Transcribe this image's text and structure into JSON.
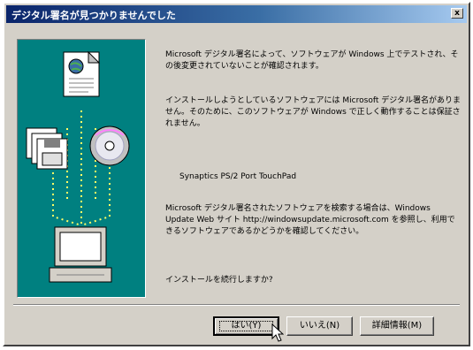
{
  "window": {
    "title": "デジタル署名が見つかりませんでした",
    "close_label": "x"
  },
  "messages": {
    "line1": "Microsoft デジタル署名によって、ソフトウェアが Windows 上でテストされ、その後変更されていないことが確認されます。",
    "line2": "インストールしようとしているソフトウェアには Microsoft デジタル署名がありません。そのために、このソフトウェアが Windows で正しく動作することは保証されません。",
    "device_name": "Synaptics PS/2 Port TouchPad",
    "line3": "Microsoft デジタル署名されたソフトウェアを検索する場合は、Windows Update Web サイト http://windowsupdate.microsoft.com を参照し、利用できるソフトウェアであるかどうかを確認してください。",
    "question": "インストールを続行しますか?"
  },
  "buttons": {
    "yes": "はい(Y)",
    "no": "いいえ(N)",
    "details": "詳細情報(M)"
  },
  "icons": [
    "document-globe-icon",
    "floppy-disks-icon",
    "cd-disc-icon",
    "computer-icon",
    "close-icon",
    "mouse-cursor-icon"
  ],
  "colors": {
    "titlebar": "#0a246a",
    "panel": "#008080",
    "dialog_bg": "#d4d0c8"
  }
}
